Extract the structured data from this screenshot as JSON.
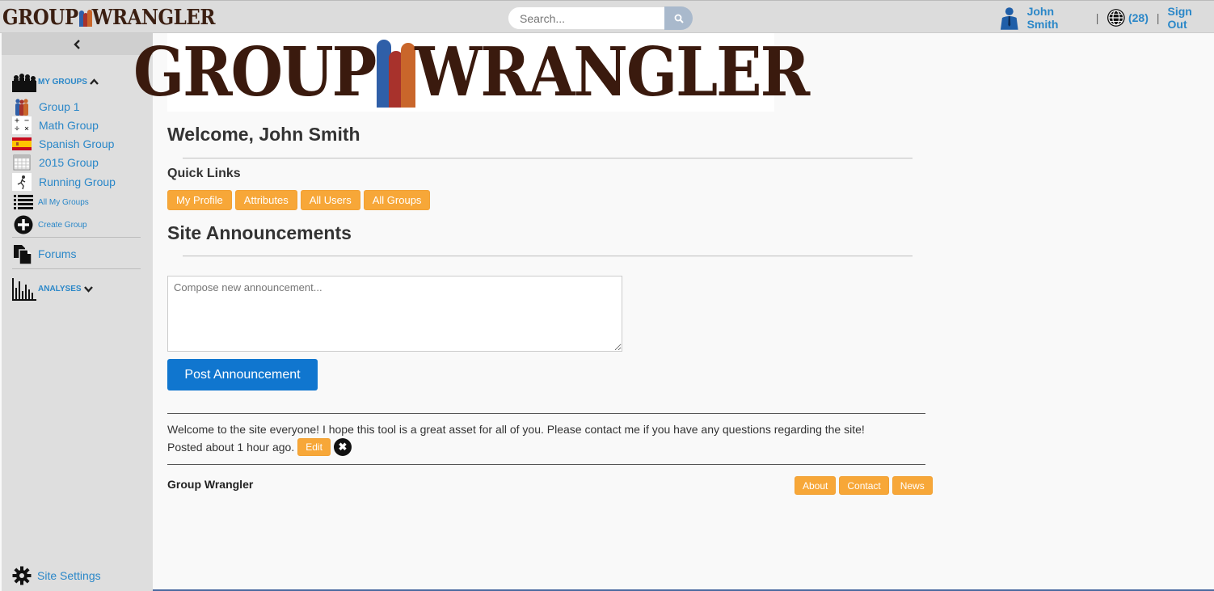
{
  "app": {
    "brand_left": "GROUP",
    "brand_right": "WRANGLER"
  },
  "search": {
    "placeholder": "Search..."
  },
  "usernav": {
    "user_name": "John Smith",
    "notification_count": "(28)",
    "sign_out": "Sign Out"
  },
  "sidebar": {
    "my_groups_label": "MY GROUPS",
    "groups": [
      {
        "label": "Group 1",
        "icon": "people-icon"
      },
      {
        "label": "Math Group",
        "icon": "math-symbols-icon"
      },
      {
        "label": "Spanish Group",
        "icon": "spain-flag-icon"
      },
      {
        "label": "2015 Group",
        "icon": "calendar-icon"
      },
      {
        "label": "Running Group",
        "icon": "runner-icon"
      }
    ],
    "all_my_groups": "All My Groups",
    "create_group": "Create Group",
    "forums": "Forums",
    "analyses_label": "ANALYSES",
    "site_settings": "Site Settings"
  },
  "banner": {
    "left": "GROUP",
    "right": "WRANGLER"
  },
  "main": {
    "welcome": "Welcome, John Smith",
    "quick_links_title": "Quick Links",
    "quick_links": [
      "My Profile",
      "Attributes",
      "All Users",
      "All Groups"
    ],
    "announcements_title": "Site Announcements",
    "compose_placeholder": "Compose new announcement...",
    "post_button": "Post Announcement",
    "announcement_text": "Welcome to the site everyone! I hope this tool is a great asset for all of you. Please contact me if you have any questions regarding the site!",
    "announcement_meta": "Posted about 1 hour ago.",
    "edit_label": "Edit"
  },
  "footer": {
    "brand": "Group Wrangler",
    "links": [
      "About",
      "Contact",
      "News"
    ]
  },
  "colors": {
    "accent_blue": "#2a87c8",
    "orange": "#f7a738",
    "primary_button": "#1076cf",
    "brand_brown": "#3a1a0e"
  }
}
